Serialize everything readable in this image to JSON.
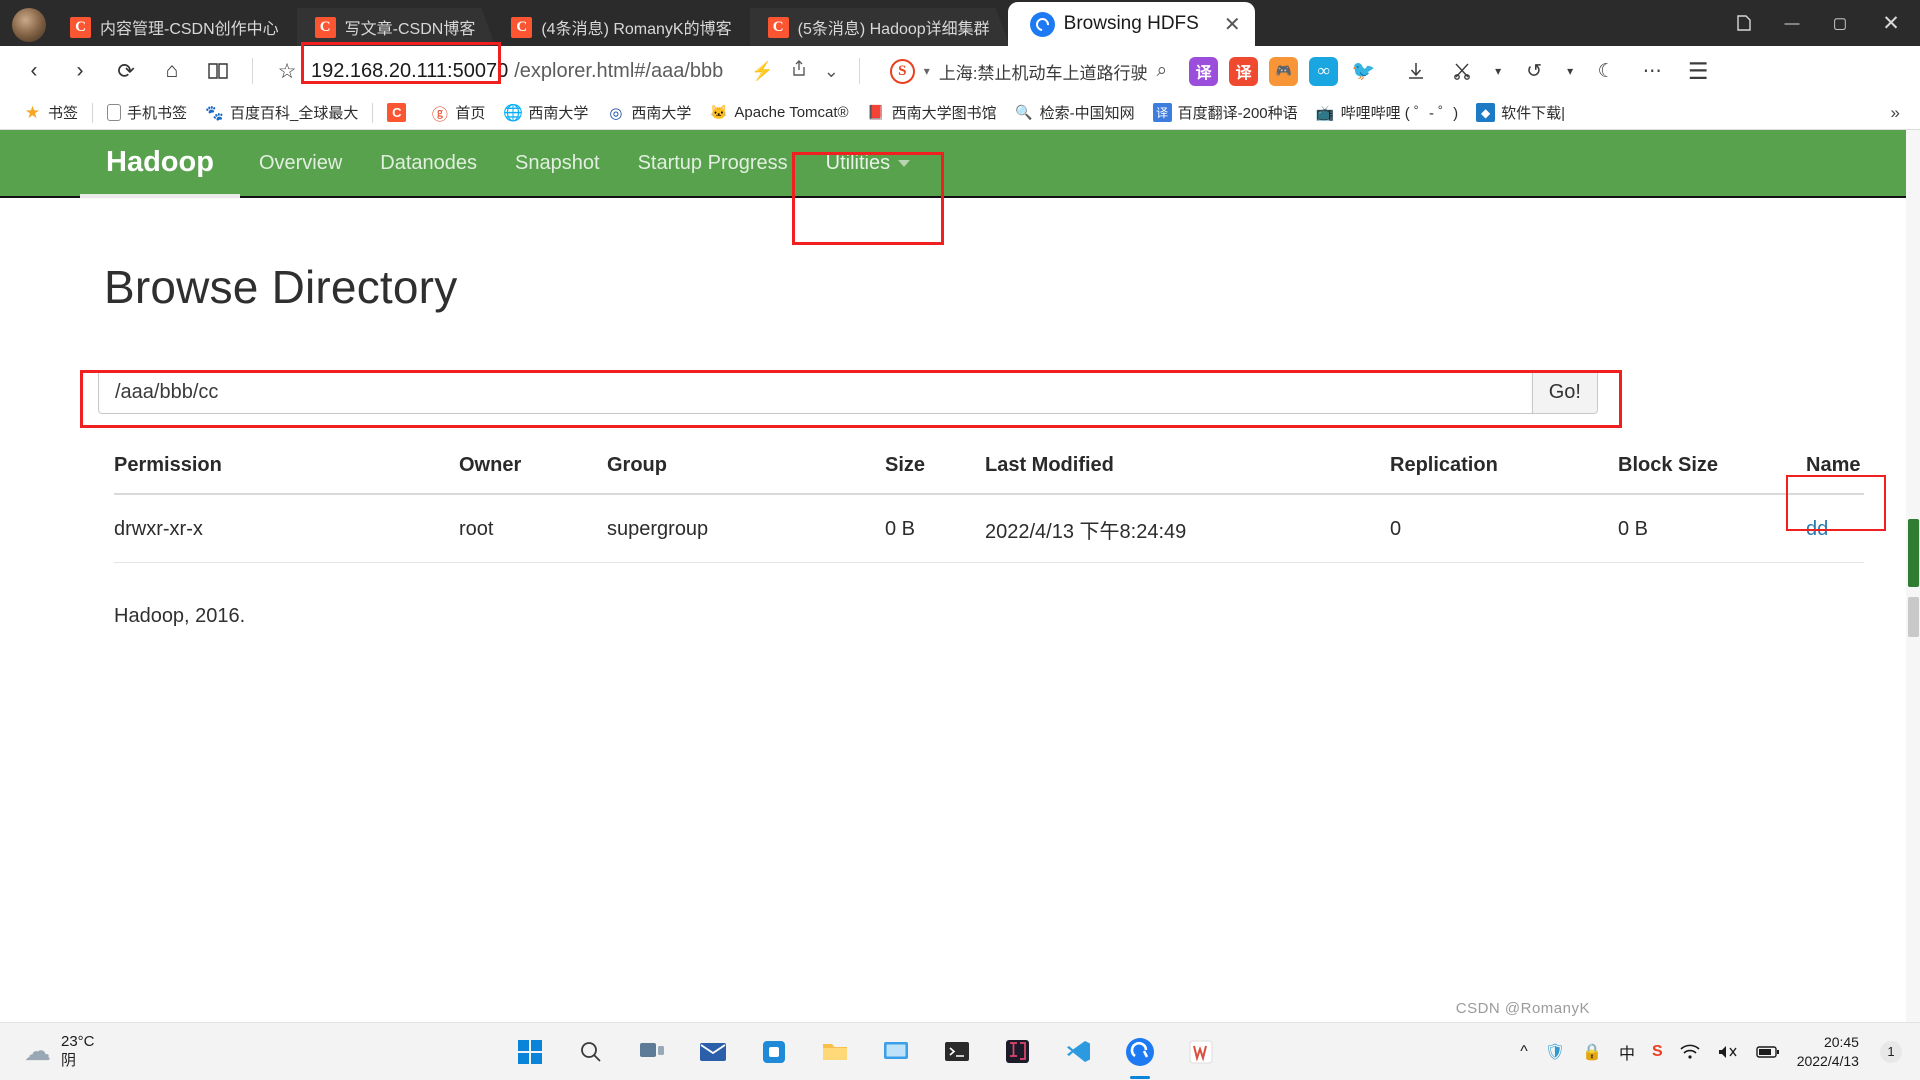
{
  "window": {
    "controls": {
      "collections": "collections-icon",
      "minimize": "—",
      "maximize": "▢",
      "close": "✕"
    }
  },
  "tabs": [
    {
      "label": "内容管理-CSDN创作中心",
      "favicon": "csdn-icon",
      "active": false
    },
    {
      "label": "写文章-CSDN博客",
      "favicon": "csdn-icon",
      "active": false
    },
    {
      "label": "(4条消息) RomanyK的博客",
      "favicon": "csdn-icon",
      "active": false
    },
    {
      "label": "(5条消息) Hadoop详细集群",
      "favicon": "csdn-icon",
      "active": false
    },
    {
      "label": "Browsing HDFS",
      "favicon": "hdfs-icon",
      "active": true
    }
  ],
  "toolbar": {
    "back": "‹",
    "forward": "›",
    "refresh": "⟳",
    "home": "⌂",
    "reading_list": "read-icon",
    "favorite_star": "☆",
    "url_host": "192.168.20.111:50070",
    "url_path": "/explorer.html#/aaa/bbb",
    "split_screen": "⚡",
    "share": "share-icon",
    "chevron": "⌄",
    "search_engine": "S",
    "search_keyword": "上海:禁止机动车上道路行驶",
    "search_magnifier": "search-icon",
    "extensions": [
      {
        "name": "translate-purple-ext",
        "glyph": "译",
        "color": "#9b4edb"
      },
      {
        "name": "translate-red-ext",
        "glyph": "译",
        "color": "#ef4930"
      },
      {
        "name": "game-ext",
        "glyph": "🎮",
        "color": "#f89537"
      },
      {
        "name": "infinity-ext",
        "glyph": "∞",
        "color": "#1aa6e0"
      },
      {
        "name": "bird-ext",
        "glyph": "🐦",
        "color": "#ffffff"
      }
    ],
    "download": "download-icon",
    "cut_tool": "scissors-icon",
    "history": "↺",
    "dark_mode": "☾",
    "more": "⋯",
    "menu": "☰"
  },
  "bookmarks": [
    {
      "label": "书签",
      "icon": "star-icon",
      "color": "#f5a623"
    },
    {
      "label": "手机书签",
      "icon": "phone-icon",
      "color": "#888888"
    },
    {
      "label": "百度百科_全球最大",
      "icon": "baidu-icon",
      "color": "#2d57c8"
    },
    {
      "label": "",
      "icon": "csdn-icon",
      "color": "#fc5531"
    },
    {
      "label": "首页",
      "icon": "sogou-icon",
      "color": "#e8401f"
    },
    {
      "label": "西南大学",
      "icon": "globe-icon",
      "color": "#555555"
    },
    {
      "label": "西南大学",
      "icon": "swu-seal-icon",
      "color": "#1b4fa0"
    },
    {
      "label": "Apache Tomcat®",
      "icon": "tomcat-icon",
      "color": "#b8860b"
    },
    {
      "label": "西南大学图书馆",
      "icon": "library-icon",
      "color": "#8b1a1a"
    },
    {
      "label": "检索-中国知网",
      "icon": "cnki-icon",
      "color": "#1d7ac4"
    },
    {
      "label": "百度翻译-200种语",
      "icon": "fanyi-icon",
      "color": "#3e7de0"
    },
    {
      "label": "哔哩哔哩 ( ゜- ゜)",
      "icon": "bilibili-icon",
      "color": "#fb7299"
    },
    {
      "label": "软件下载|",
      "icon": "software-icon",
      "color": "#1d7ac4"
    }
  ],
  "bookmarks_overflow": "»",
  "hadoop": {
    "brand": "Hadoop",
    "nav": [
      {
        "label": "Overview",
        "name": "overview"
      },
      {
        "label": "Datanodes",
        "name": "datanodes"
      },
      {
        "label": "Snapshot",
        "name": "snapshot"
      },
      {
        "label": "Startup Progress",
        "name": "startup-progress"
      },
      {
        "label": "Utilities",
        "name": "utilities",
        "has_caret": true
      }
    ],
    "page_title": "Browse Directory",
    "path_value": "/aaa/bbb/cc",
    "go_label": "Go!",
    "columns": [
      "Permission",
      "Owner",
      "Group",
      "Size",
      "Last Modified",
      "Replication",
      "Block Size",
      "Name"
    ],
    "rows": [
      {
        "permission": "drwxr-xr-x",
        "owner": "root",
        "group": "supergroup",
        "size": "0 B",
        "last_modified": "2022/4/13 下午8:24:49",
        "replication": "0",
        "block_size": "0 B",
        "name": "dd"
      }
    ],
    "footer": "Hadoop, 2016."
  },
  "accent_colors": {
    "hadoop_green": "#58a14d",
    "annotation_red": "#f02020",
    "link_blue": "#2a7ab0"
  },
  "taskbar": {
    "weather_temp": "23°C",
    "weather_desc": "阴",
    "weather_icon": "cloud-icon",
    "apps": [
      {
        "name": "start-button",
        "glyph": "⊞",
        "color": "#0a84d8"
      },
      {
        "name": "search-taskbar",
        "glyph": "search-icon",
        "color": "#3a3a3a"
      },
      {
        "name": "task-view",
        "glyph": "task-view-icon",
        "color": "#3a3a3a"
      },
      {
        "name": "mail",
        "glyph": "mail-icon",
        "color": "#2b5faa"
      },
      {
        "name": "store",
        "glyph": "store-icon",
        "color": "#1f8bd8"
      },
      {
        "name": "file-explorer",
        "glyph": "folder-icon",
        "color": "#f6c049"
      },
      {
        "name": "display-settings",
        "glyph": "monitor-icon",
        "color": "#3b9ee8"
      },
      {
        "name": "terminal",
        "glyph": "terminal-icon",
        "color": "#2a2a2a"
      },
      {
        "name": "intellij-idea",
        "glyph": "idea-icon",
        "color": "#e2466c"
      },
      {
        "name": "vscode",
        "glyph": "vscode-icon",
        "color": "#2b9ae0"
      },
      {
        "name": "edge-browser",
        "glyph": "edge-icon",
        "color": "#1d7af2"
      },
      {
        "name": "wps-writer",
        "glyph": "wps-icon",
        "color": "#d94f3d"
      }
    ],
    "tray": [
      {
        "name": "show-hidden-icons",
        "glyph": "^"
      },
      {
        "name": "shield-icon",
        "glyph": "🛡"
      },
      {
        "name": "security-icon",
        "glyph": "🔒"
      },
      {
        "name": "ime-indicator",
        "glyph": "中"
      },
      {
        "name": "sogou-ime",
        "glyph": "S"
      },
      {
        "name": "network-icon",
        "glyph": "wifi"
      },
      {
        "name": "volume-icon",
        "glyph": "speaker"
      },
      {
        "name": "battery-icon",
        "glyph": "battery"
      }
    ],
    "clock_time": "20:45",
    "clock_date": "2022/4/13",
    "notification_count": "1"
  },
  "watermark": "CSDN @RomanyK"
}
